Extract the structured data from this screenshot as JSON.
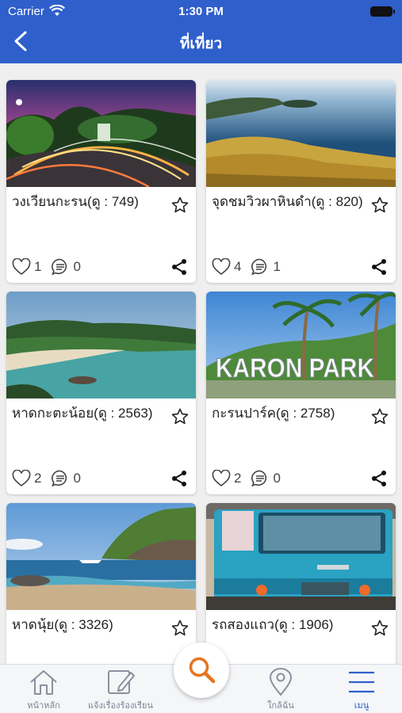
{
  "status_bar": {
    "carrier": "Carrier",
    "time": "1:30 PM"
  },
  "header": {
    "title": "ที่เที่ยว"
  },
  "places": [
    {
      "title": "วงเวียนกะรน(ดู : 749)",
      "likes": "1",
      "comments": "0"
    },
    {
      "title": "จุดชมวิวผาหินดำ(ดู : 820)",
      "likes": "4",
      "comments": "1"
    },
    {
      "title": "หาดกะตะน้อย(ดู : 2563)",
      "likes": "2",
      "comments": "0"
    },
    {
      "title": "กะรนปาร์ค(ดู : 2758)",
      "likes": "2",
      "comments": "0"
    },
    {
      "title": "หาดนุ้ย(ดู : 3326)",
      "likes": "",
      "comments": ""
    },
    {
      "title": "รถสองแถว(ดู : 1906)",
      "likes": "",
      "comments": ""
    }
  ],
  "images": {
    "karon_sign": "KARON PARK"
  },
  "tabbar": {
    "home": "หน้าหลัก",
    "report": "แจ้งเรื่องร้องเรียน",
    "nearby": "ใกล้ฉัน",
    "menu": "เมนู"
  },
  "colors": {
    "header": "#2f5fcb",
    "accent": "#e8731f"
  }
}
